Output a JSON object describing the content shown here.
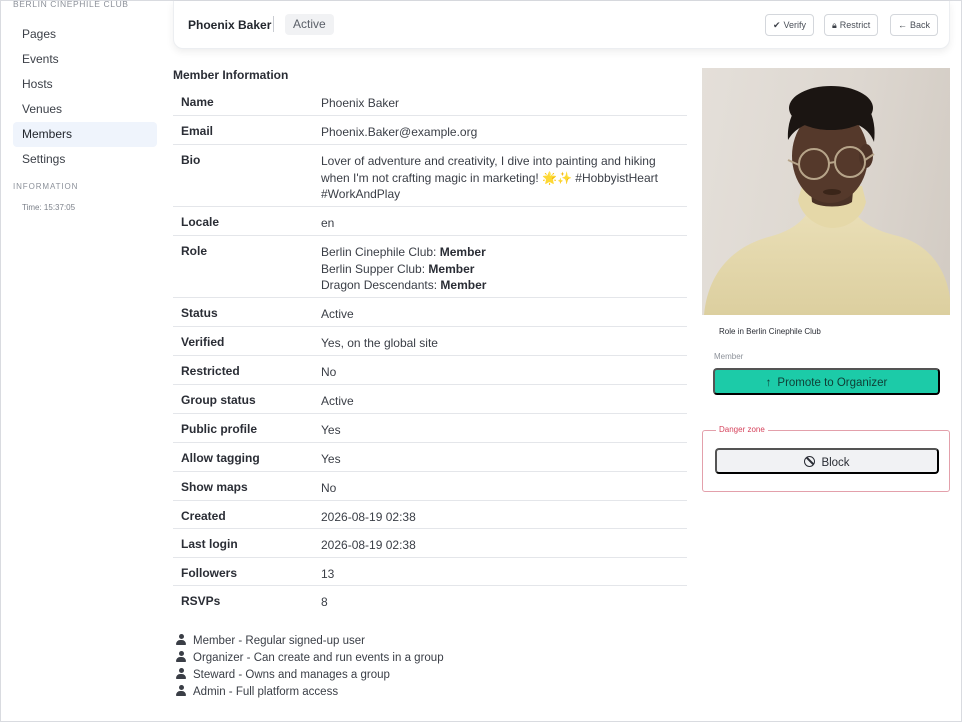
{
  "app": {
    "club_name": "BERLIN CINEPHILE CLUB"
  },
  "sidebar": {
    "items": [
      {
        "label": "Pages"
      },
      {
        "label": "Events"
      },
      {
        "label": "Hosts"
      },
      {
        "label": "Venues"
      },
      {
        "label": "Members",
        "active": true
      },
      {
        "label": "Settings"
      }
    ],
    "info_heading": "INFORMATION",
    "time": "Time: 15:37:05"
  },
  "header": {
    "member_name": "Phoenix Baker",
    "status": "Active",
    "verify_label": "Verify",
    "restrict_label": "Restrict",
    "back_label": "Back"
  },
  "member_info": {
    "title": "Member Information",
    "rows": [
      {
        "label": "Name",
        "value": "Phoenix Baker"
      },
      {
        "label": "Email",
        "value": "Phoenix.Baker@example.org"
      },
      {
        "label": "Bio",
        "value": "Lover of adventure and creativity, I dive into painting and hiking when I'm not crafting magic in marketing! 🌟✨ #HobbyistHeart #WorkAndPlay"
      },
      {
        "label": "Locale",
        "value": "en"
      },
      {
        "label": "Role",
        "roles": [
          {
            "group": "Berlin Cinephile Club:",
            "role": "Member"
          },
          {
            "group": "Berlin Supper Club:",
            "role": "Member"
          },
          {
            "group": "Dragon Descendants:",
            "role": "Member"
          }
        ]
      },
      {
        "label": "Status",
        "value": "Active"
      },
      {
        "label": "Verified",
        "value": "Yes, on the global site"
      },
      {
        "label": "Restricted",
        "value": "No"
      },
      {
        "label": "Group status",
        "value": "Active"
      },
      {
        "label": "Public profile",
        "value": "Yes"
      },
      {
        "label": "Allow tagging",
        "value": "Yes"
      },
      {
        "label": "Show maps",
        "value": "No"
      },
      {
        "label": "Created",
        "value": "2026-08-19 02:38"
      },
      {
        "label": "Last login",
        "value": "2026-08-19 02:38"
      },
      {
        "label": "Followers",
        "value": "13"
      },
      {
        "label": "RSVPs",
        "value": "8"
      }
    ]
  },
  "legend": [
    "Member - Regular signed-up user",
    "Organizer - Can create and run events in a group",
    "Steward - Owns and manages a group",
    "Admin - Full platform access"
  ],
  "side_panel": {
    "role_heading": "Role in Berlin Cinephile Club",
    "role_value": "Member",
    "promote_label": "Promote to Organizer",
    "danger_zone_label": "Danger zone",
    "block_label": "Block"
  },
  "colors": {
    "accent": "#1ccba8",
    "danger": "#d6435c",
    "active_nav_bg": "#eff4fc"
  }
}
